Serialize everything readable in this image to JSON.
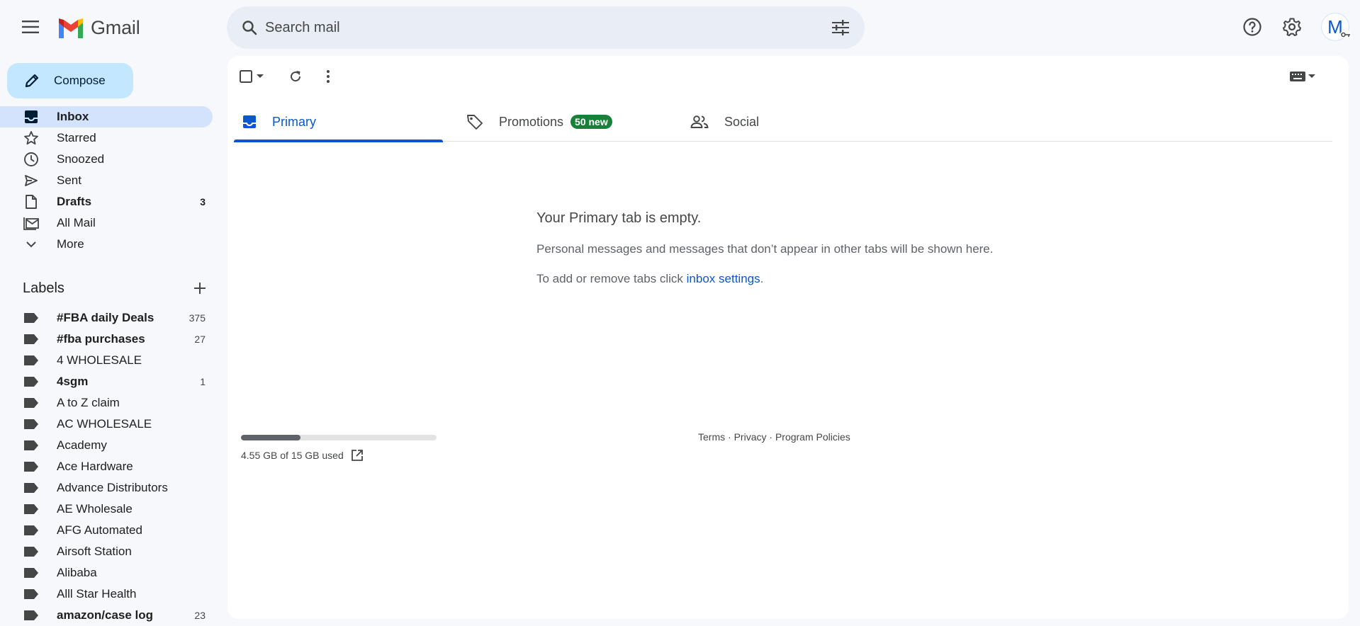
{
  "app": {
    "name": "Gmail"
  },
  "search": {
    "placeholder": "Search mail"
  },
  "account": {
    "initial": "M"
  },
  "compose": {
    "label": "Compose"
  },
  "nav": {
    "items": [
      {
        "label": "Inbox",
        "count": "",
        "icon": "inbox-icon",
        "active": true
      },
      {
        "label": "Starred",
        "count": "",
        "icon": "star-icon"
      },
      {
        "label": "Snoozed",
        "count": "",
        "icon": "clock-icon"
      },
      {
        "label": "Sent",
        "count": "",
        "icon": "send-icon"
      },
      {
        "label": "Drafts",
        "count": "3",
        "icon": "draft-icon",
        "bold": true
      },
      {
        "label": "All Mail",
        "count": "",
        "icon": "all-mail-icon"
      },
      {
        "label": "More",
        "count": "",
        "icon": "chevron-down-icon"
      }
    ]
  },
  "labels": {
    "title": "Labels",
    "items": [
      {
        "label": "#FBA daily Deals",
        "count": "375",
        "bold": true
      },
      {
        "label": "#fba purchases",
        "count": "27",
        "bold": true
      },
      {
        "label": "4 WHOLESALE",
        "count": ""
      },
      {
        "label": "4sgm",
        "count": "1",
        "bold": true
      },
      {
        "label": "A to Z claim",
        "count": ""
      },
      {
        "label": "AC WHOLESALE",
        "count": ""
      },
      {
        "label": "Academy",
        "count": ""
      },
      {
        "label": "Ace Hardware",
        "count": ""
      },
      {
        "label": "Advance Distributors",
        "count": ""
      },
      {
        "label": "AE Wholesale",
        "count": ""
      },
      {
        "label": "AFG Automated",
        "count": ""
      },
      {
        "label": "Airsoft Station",
        "count": ""
      },
      {
        "label": "Alibaba",
        "count": ""
      },
      {
        "label": "Alll Star Health",
        "count": ""
      },
      {
        "label": "amazon/case log",
        "count": "23",
        "bold": true
      }
    ]
  },
  "tabs": [
    {
      "label": "Primary",
      "icon": "inbox-icon",
      "active": true,
      "badge": ""
    },
    {
      "label": "Promotions",
      "icon": "tag-icon",
      "badge": "50 new"
    },
    {
      "label": "Social",
      "icon": "people-icon",
      "badge": ""
    }
  ],
  "empty": {
    "title": "Your Primary tab is empty.",
    "line1": "Personal messages and messages that don’t appear in other tabs will be shown here.",
    "line2_prefix": "To add or remove tabs click ",
    "line2_link": "inbox settings",
    "line2_suffix": "."
  },
  "storage": {
    "text": "4.55 GB of 15 GB used",
    "used_fraction": 0.303
  },
  "footer": {
    "terms": "Terms",
    "sep": " · ",
    "privacy": "Privacy",
    "policies": "Program Policies"
  },
  "colors": {
    "accent": "#0b57d0",
    "compose_bg": "#c2e7ff",
    "active_nav": "#d3e3fd",
    "badge": "#188038",
    "page_bg": "#f6f8fc"
  }
}
